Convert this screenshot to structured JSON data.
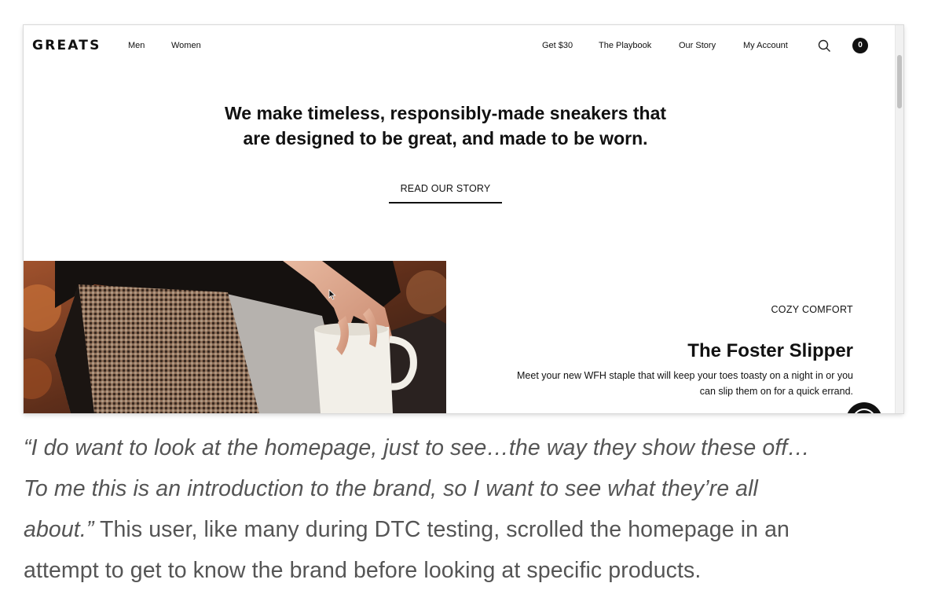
{
  "site": {
    "logo": "GREATS",
    "nav_left": [
      "Men",
      "Women"
    ],
    "nav_right": [
      "Get $30",
      "The Playbook",
      "Our Story",
      "My Account"
    ],
    "search_icon": "search-icon",
    "cart_count": "0",
    "hero": {
      "line1": "We make timeless, responsibly-made sneakers that",
      "line2": "are designed to be great, and made to be worn.",
      "cta": "READ OUR STORY"
    },
    "feature": {
      "image": "photo of hand holding a white coffee mug over a houndstooth coat",
      "eyebrow": "COZY COMFORT",
      "title": "The Foster Slipper",
      "desc_line1": "Meet your new WFH staple that will keep your toes toasty on a night in or you",
      "desc_line2": "can slip them on for a quick errand."
    },
    "chat_icon": "chat-icon"
  },
  "article": {
    "quote_line1": "“I do want to look at the homepage, just to see…the way they show these off…",
    "quote_line2": "To me this is an introduction to the brand, so I want to see what they’re all",
    "quote_line3_italic": "about.”",
    "line3_rest": " This user, like many during DTC testing, scrolled the homepage in an",
    "line4": "attempt to get to know the brand before looking at specific products."
  },
  "colors": {
    "brand_black": "#111111",
    "article_gray": "#555555"
  }
}
